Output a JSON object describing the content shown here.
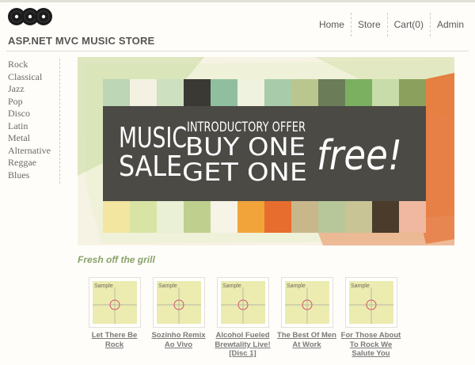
{
  "header": {
    "logo_icon": "vinyl-records-icon",
    "title": "ASP.NET MVC MUSIC STORE",
    "nav": [
      "Home",
      "Store",
      "Cart(0)",
      "Admin"
    ]
  },
  "sidebar": {
    "genres": [
      "Rock",
      "Classical",
      "Jazz",
      "Pop",
      "Disco",
      "Latin",
      "Metal",
      "Alternative",
      "Reggae",
      "Blues"
    ]
  },
  "banner": {
    "word_1": "MUSIC",
    "word_2": "SALE",
    "line_small": "INTRODUCTORY OFFER",
    "line_1": "BUY ONE",
    "line_2": "GET ONE",
    "script_word": "free!"
  },
  "main": {
    "heading_plain": "Fresh",
    "heading_emphasis": "off the grill",
    "albums": [
      {
        "thumb_label": "Sample",
        "title": "Let There Be Rock"
      },
      {
        "thumb_label": "Sample",
        "title": "Sozinho Remix Ao Vivo"
      },
      {
        "thumb_label": "Sample",
        "title": "Alcohol Fueled Brewtality Live! [Disc 1]"
      },
      {
        "thumb_label": "Sample",
        "title": "The Best Of Men At Work"
      },
      {
        "thumb_label": "Sample",
        "title": "For Those About To Rock We Salute You"
      }
    ]
  },
  "colors": {
    "background": "#fefdf9",
    "banner_band": "#4b4a45",
    "thumb_bg": "#ecebb0"
  }
}
